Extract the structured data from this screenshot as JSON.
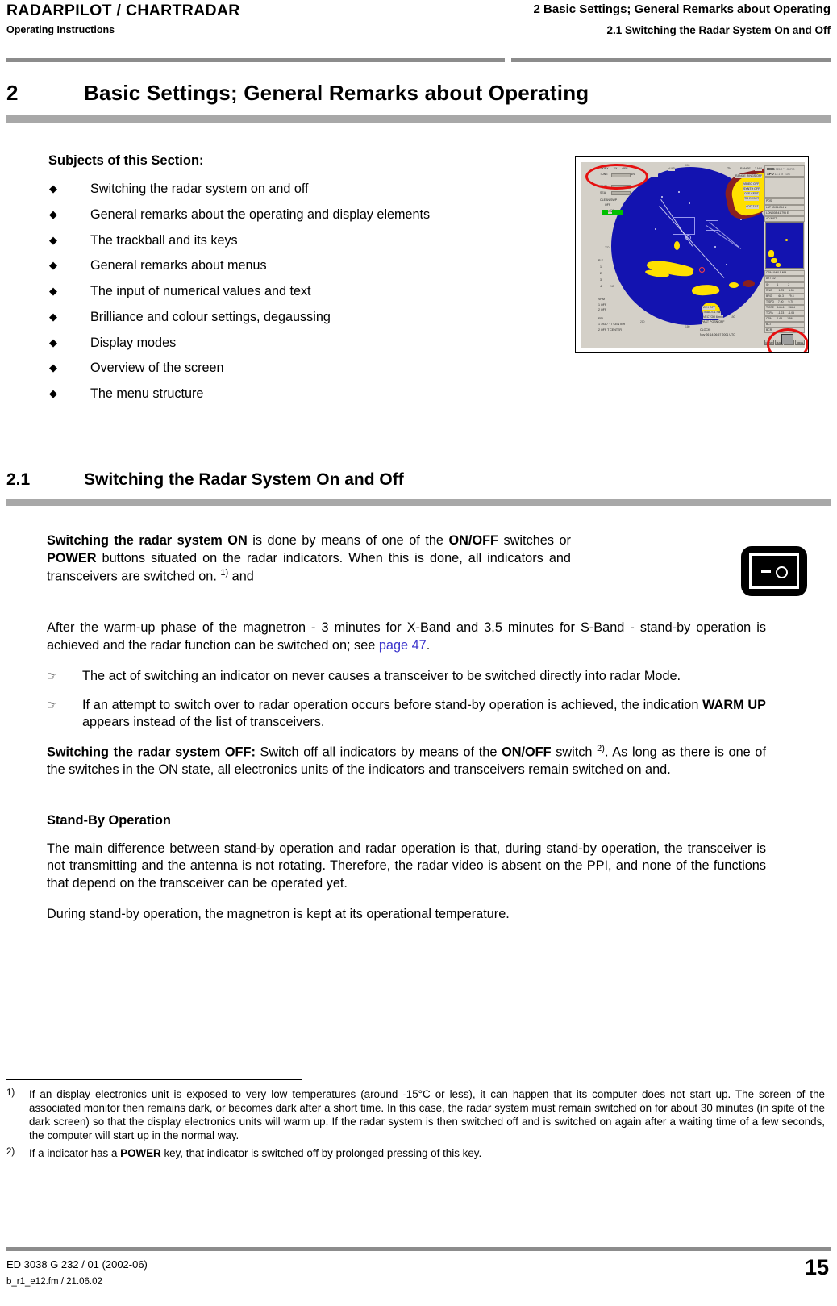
{
  "header": {
    "product_title": "RADARPILOT / CHARTRADAR",
    "doc_type": "Operating Instructions",
    "chapter_ref": "2  Basic Settings; General Remarks about Operating",
    "section_ref": "2.1  Switching the Radar System On and Off"
  },
  "chapter": {
    "number": "2",
    "title": "Basic Settings; General Remarks about Operating"
  },
  "subjects": {
    "title": "Subjects of this Section:",
    "bullet_glyph": "◆",
    "items": [
      "Switching the radar system on and off",
      "General remarks about the operating and display elements",
      "The trackball and its keys",
      "General remarks about menus",
      "The input of numerical values and text",
      "Brilliance and colour settings, degaussing",
      "Display modes",
      "Overview of the screen",
      "The menu structure"
    ]
  },
  "radar_figure": {
    "name": "radar-ppi-screenshot",
    "top_labels": {
      "txrx": "TX/RX",
      "txrx_value": "XX",
      "txrx_off": "OFF",
      "tune": "TUNE",
      "tune_value": "MAN",
      "orientation": "N UP",
      "motion": "TM",
      "range_label": "RANGE",
      "range_value": "3 NM"
    },
    "left_controls": [
      "RAIN",
      "SEA",
      "CLEAN SWP",
      "OFF",
      "ON"
    ],
    "right_controls": [
      "RANGE RINGS   OFF",
      "VIDEO OFF",
      "SYNTH OFF",
      "OFF CENT",
      "TM RESET",
      "ADD TGT"
    ],
    "bottom_controls": [
      "PATH      OFF",
      "TRAILS  1 min",
      "VECTOR  6 min",
      "PAST POSN  OFF",
      "CLOCK:"
    ],
    "clock_text": "Nov 26  14:06:57  2001  UTC",
    "vrm": [
      "VRM",
      "1   OFF",
      "2   OFF"
    ],
    "ebl": [
      "EBL",
      "1 193.7 ° T  CENTER",
      "2     OFF    T  CENTER"
    ],
    "data_panel": {
      "hdg_label": "HDG",
      "hdg_value": "325.2 °",
      "spd_label": "SPD",
      "spd_value": "12.1 kt",
      "gyro": "GYRO",
      "log": "LOG",
      "pos_label": "POS",
      "lat": "LAT  53:54.264 N",
      "lon": "LON 008:41.795 E",
      "adjust": "ADJUST"
    },
    "target_table": {
      "headers": [
        "ID",
        "1",
        "2"
      ],
      "rows": [
        [
          "RNG",
          "1.73",
          "1.56"
        ],
        [
          "BRG",
          "66.3",
          "79.3"
        ],
        [
          "T SPD",
          "7.90",
          "9.70"
        ],
        [
          "T CSE",
          "143.6",
          "156.4"
        ],
        [
          "TCPA",
          "-1.23",
          "-1.05"
        ],
        [
          "CPA",
          "1.65",
          "1.56"
        ],
        [
          "BCT",
          "",
          ""
        ],
        [
          "BCR",
          "",
          ""
        ]
      ]
    },
    "menu_buttons": [
      "MENU",
      "MAP",
      "TRACK",
      "BRILL"
    ],
    "cpa_lim": "CPA LIM     0.5 NM",
    "az_g2": "AZ / G2",
    "colors": {
      "ppi_background": "#1313b0",
      "land": "#ffe000",
      "land_shadow": "#8a2020",
      "panel": "#d4d0c8",
      "annotation": "#e51010",
      "indicator_on": "#00c000"
    },
    "annotations": [
      "red-ellipse-txrx-tune",
      "red-ellipse-brill-button"
    ]
  },
  "section": {
    "number": "2.1",
    "title": "Switching the Radar System On and Off"
  },
  "body": {
    "para_on": {
      "lead": "Switching the radar system ON",
      "t1": " is done by means of one of the ",
      "b1": "ON/OFF",
      "t2": " switches or ",
      "b2": "POWER",
      "t3": " buttons situated on the radar indicators. When this is done, all indicators and transceivers are switched on. ",
      "fn": "1)",
      "t4": " and"
    },
    "para_warmup": {
      "t1": "After the warm-up phase of the magnetron - 3 minutes for X-Band and 3.5 minutes for S-Band - stand-by operation is achieved and the radar function can be switched on; see ",
      "link": "page 47",
      "t2": "."
    },
    "note_glyph": "☞",
    "note1": "The act of switching an indicator on never causes a transceiver to be switched directly into radar Mode.",
    "note2": {
      "t1": "If an attempt to switch over to radar operation occurs before stand-by operation is achieved, the indication ",
      "b1": "WARM UP",
      "t2": " appears instead of the list of transceivers."
    },
    "para_off": {
      "lead": "Switching the radar system OFF:",
      "t1": " Switch off all indicators by means of the ",
      "b1": "ON/OFF",
      "t2": " switch ",
      "fn": "2)",
      "t3": ". As long as there is one of the switches in the ON state, all electronics units of the indicators and transceivers remain switched on and."
    },
    "standby_heading": "Stand-By Operation",
    "standby_para1": "The main difference between stand-by operation and radar operation is that, during stand-by operation, the transceiver is not transmitting and the antenna is not rotating. Therefore, the radar video is absent on the PPI, and none of the functions that depend on the transceiver can be operated yet.",
    "standby_para2": "During stand-by operation, the magnetron is kept at its operational temperature."
  },
  "switch_icon": {
    "name": "on-off-rocker-switch",
    "off_symbol": "—",
    "on_symbol": "○"
  },
  "footnotes": [
    {
      "marker": "1)",
      "text": "If an display electronics unit is exposed to very low temperatures (around -15°C or less), it can happen that its computer does not start up. The screen of the associated monitor then remains dark, or becomes dark after a short time. In this case, the radar system must remain switched on for about 30 minutes (in spite of the dark screen) so that the display electronics units will warm up. If the radar system is then switched off and is switched on again after a waiting time of a few seconds, the computer will start up in the normal way."
    },
    {
      "marker": "2)",
      "bold_term": "POWER",
      "prefix": "If a indicator has a ",
      "suffix": " key, that indicator is switched off by prolonged pressing of this key."
    }
  ],
  "footer": {
    "doc_id": "ED 3038 G 232 / 01 (2002-06)",
    "file_ref": "b_r1_e12.fm / 21.06.02",
    "page_number": "15"
  }
}
